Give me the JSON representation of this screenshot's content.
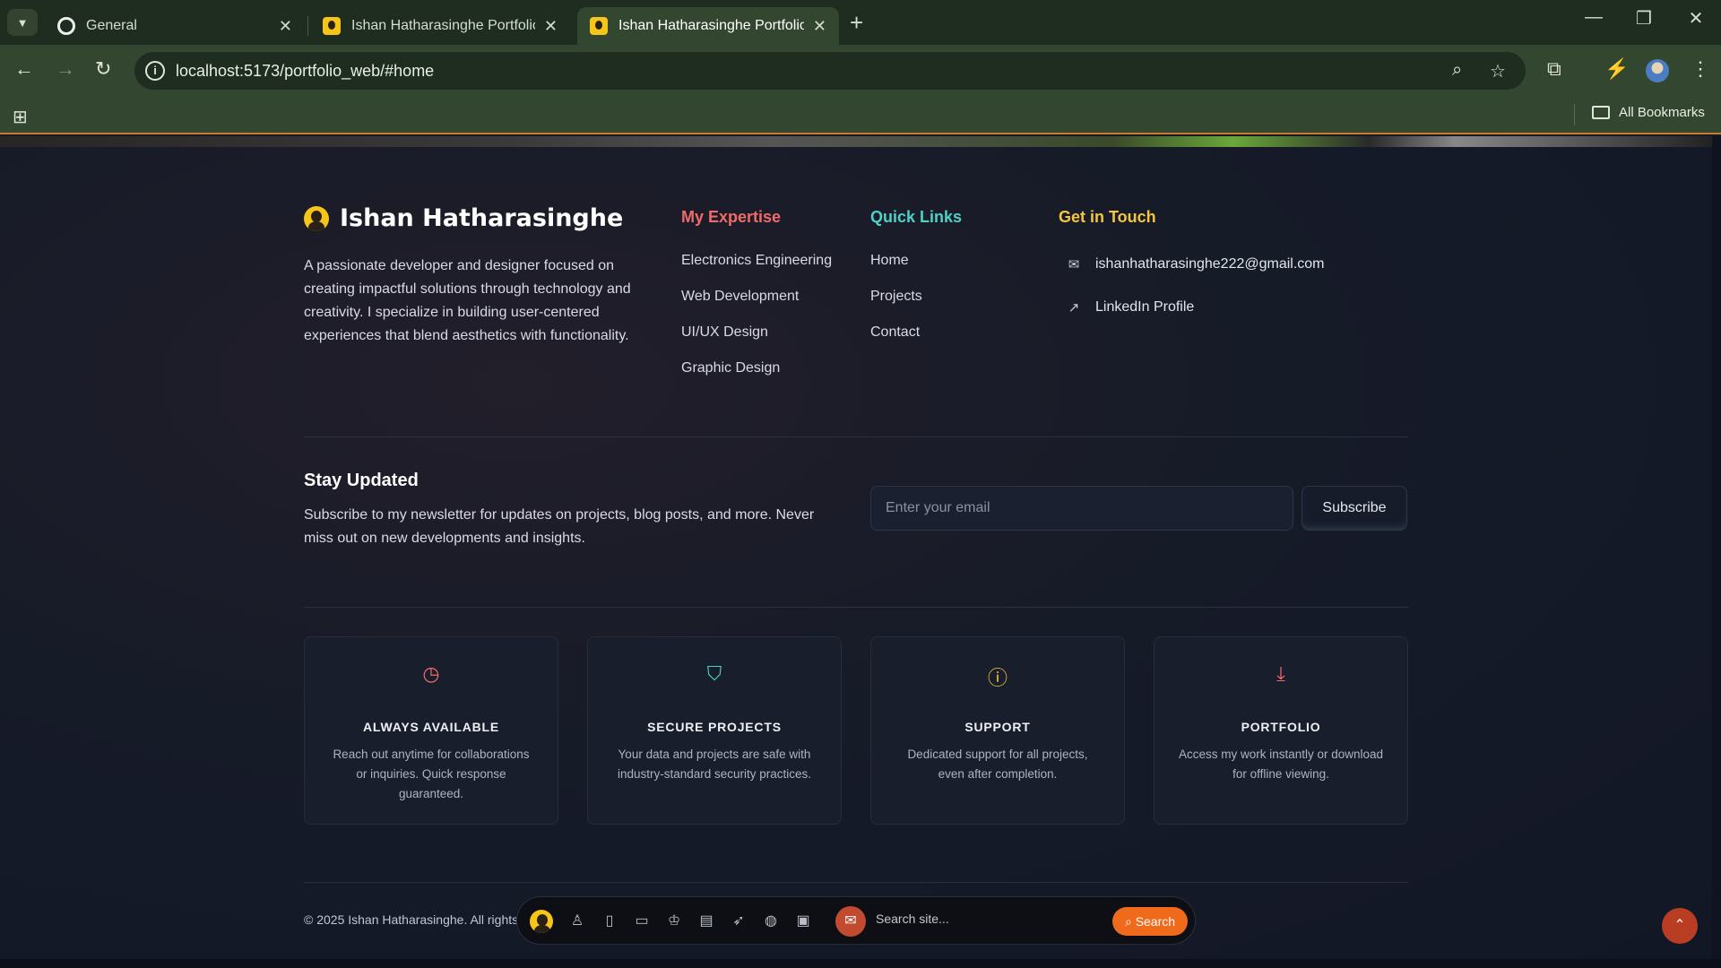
{
  "browser": {
    "tabs": [
      {
        "title": "General"
      },
      {
        "title": "Ishan Hatharasinghe Portfolio"
      },
      {
        "title": "Ishan Hatharasinghe Portfolio"
      }
    ],
    "url": "localhost:5173/portfolio_web/#home",
    "bookmarks_label": "All Bookmarks"
  },
  "footer": {
    "brand": "Ishan Hatharasinghe",
    "about": "A passionate developer and designer focused on creating impactful solutions through technology and creativity. I specialize in building user-centered experiences that blend aesthetics with functionality.",
    "expertise": {
      "title": "My Expertise",
      "items": [
        "Electronics Engineering",
        "Web Development",
        "UI/UX Design",
        "Graphic Design"
      ]
    },
    "quick_links": {
      "title": "Quick Links",
      "items": [
        "Home",
        "Projects",
        "Contact"
      ]
    },
    "contact": {
      "title": "Get in Touch",
      "email": "ishanhatharasinghe222@gmail.com",
      "linkedin": "LinkedIn Profile"
    },
    "newsletter": {
      "title": "Stay Updated",
      "text": "Subscribe to my newsletter for updates on projects, blog posts, and more. Never miss out on new developments and insights.",
      "placeholder": "Enter your email",
      "button": "Subscribe"
    },
    "features": [
      {
        "title": "ALWAYS AVAILABLE",
        "text": "Reach out anytime for collaborations or inquiries. Quick response guaranteed.",
        "icon": "clock-icon",
        "color": "#f06a6a"
      },
      {
        "title": "SECURE PROJECTS",
        "text": "Your data and projects are safe with industry-standard security practices.",
        "icon": "shield-icon",
        "color": "#4fd1c5"
      },
      {
        "title": "SUPPORT",
        "text": "Dedicated support for all projects, even after completion.",
        "icon": "help-circle-icon",
        "color": "#f5c542"
      },
      {
        "title": "PORTFOLIO",
        "text": "Access my work instantly or download for offline viewing.",
        "icon": "download-icon",
        "color": "#f06a6a"
      }
    ],
    "copyright": "© 2025 Ishan Hatharasinghe. All rights"
  },
  "dock": {
    "search_placeholder": "Search site...",
    "search_button": "Search"
  }
}
